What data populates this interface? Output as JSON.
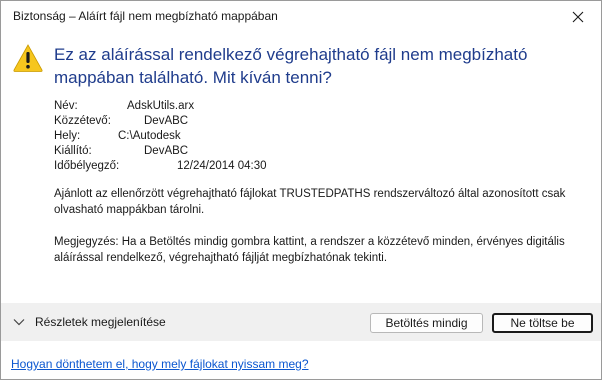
{
  "window": {
    "title": "Biztonság – Aláírt fájl nem megbízható mappában"
  },
  "headline": "Ez az aláírással rendelkező végrehajtható fájl nem megbízható mappában található. Mit kíván tenni?",
  "details": [
    {
      "label": "Név:",
      "value": "AdskUtils.arx"
    },
    {
      "label": "Közzétevő:",
      "value": "DevABC"
    },
    {
      "label": "Hely:",
      "value": "C:\\Autodesk"
    },
    {
      "label": "Kiállító:",
      "value": "DevABC"
    },
    {
      "label": "Időbélyegző:",
      "value": "12/24/2014 04:30"
    }
  ],
  "paragraphs": {
    "recommendation": "Ajánlott az ellenőrzött végrehajtható fájlokat TRUSTEDPATHS rendszerváltozó által azonosított csak olvasható mappákban tárolni.",
    "note": "Megjegyzés: Ha a Betöltés mindig gombra kattint, a rendszer a közzétevő minden, érvényes digitális aláírással rendelkező, végrehajtható fájlját megbízhatónak tekinti."
  },
  "footer": {
    "expander_label": "Részletek megjelenítése",
    "always_load_label": "Betöltés mindig",
    "dont_load_label": "Ne töltse be"
  },
  "help_link": "Hogyan dönthetem el, hogy mely fájlokat nyissam meg?",
  "colors": {
    "headline": "#1f3c8c",
    "link": "#0b57d0",
    "warning": "#f6c61e"
  },
  "icons": {
    "warning": "warning-icon",
    "close": "close-icon",
    "expand": "chevron-down-icon"
  }
}
